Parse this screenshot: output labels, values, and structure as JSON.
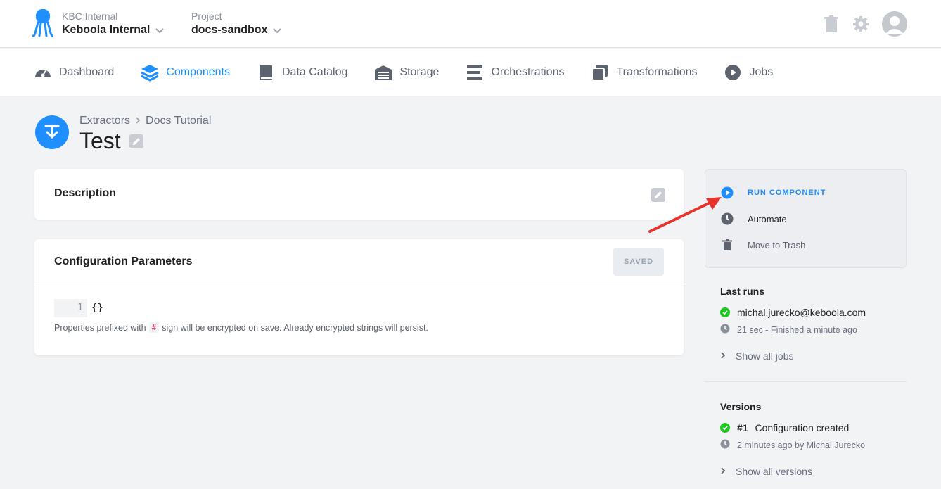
{
  "header": {
    "org_label": "KBC Internal",
    "org_name": "Keboola Internal",
    "project_label": "Project",
    "project_name": "docs-sandbox"
  },
  "nav": {
    "items": [
      {
        "label": "Dashboard",
        "icon": "dashboard-icon"
      },
      {
        "label": "Components",
        "icon": "layers-icon",
        "active": true
      },
      {
        "label": "Data Catalog",
        "icon": "book-icon"
      },
      {
        "label": "Storage",
        "icon": "warehouse-icon"
      },
      {
        "label": "Orchestrations",
        "icon": "bars-icon"
      },
      {
        "label": "Transformations",
        "icon": "copy-icon"
      },
      {
        "label": "Jobs",
        "icon": "play-circle-icon"
      }
    ]
  },
  "page": {
    "breadcrumb": [
      "Extractors",
      "Docs Tutorial"
    ],
    "title": "Test"
  },
  "description": {
    "title": "Description"
  },
  "config": {
    "title": "Configuration Parameters",
    "saved_label": "SAVED",
    "line_number": "1",
    "code": "{}",
    "hint_before": "Properties prefixed with",
    "hint_code": "#",
    "hint_after": "sign will be encrypted on save. Already encrypted strings will persist."
  },
  "actions": {
    "run": "RUN COMPONENT",
    "automate": "Automate",
    "trash": "Move to Trash"
  },
  "last_runs": {
    "title": "Last runs",
    "user": "michal.jurecko@keboola.com",
    "meta": "21 sec - Finished a minute ago",
    "show_all": "Show all jobs"
  },
  "versions": {
    "title": "Versions",
    "number": "#1",
    "desc": "Configuration created",
    "meta": "2 minutes ago by Michal Jurecko",
    "show_all": "Show all versions"
  },
  "colors": {
    "accent": "#1f8fff",
    "success": "#1ec71e",
    "annotation_arrow": "#e8322c"
  }
}
